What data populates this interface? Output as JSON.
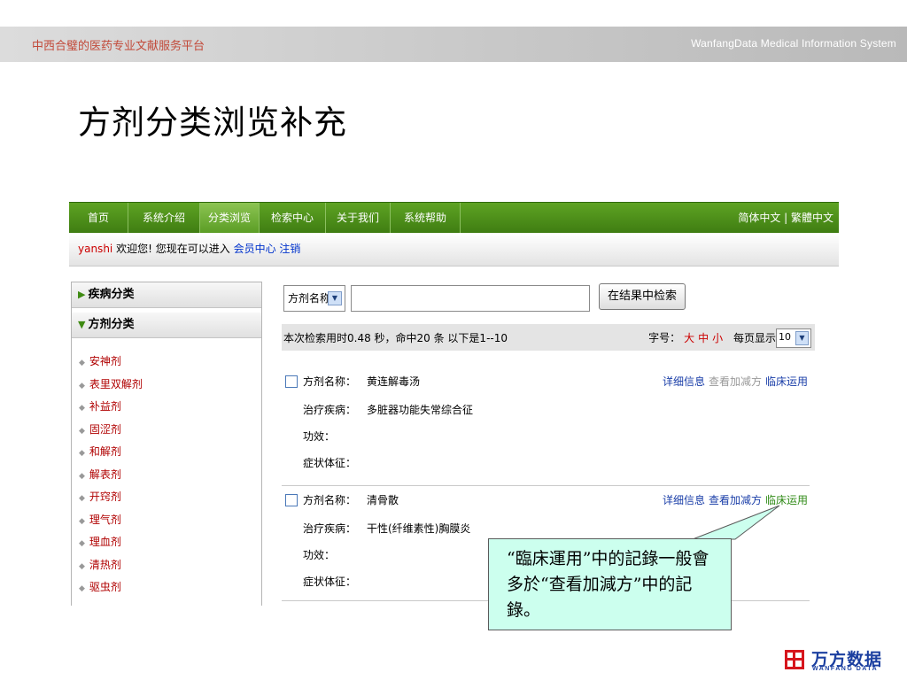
{
  "banner": {
    "left_text": "中西合璧的医药专业文献服务平台",
    "right_text": "WanfangData Medical Information System"
  },
  "slide": {
    "title": "方剂分类浏览补充"
  },
  "nav": {
    "items": [
      "首页",
      "系统介绍",
      "分类浏览",
      "检索中心",
      "关于我们",
      "系统帮助"
    ],
    "active": "分类浏览",
    "lang": "简体中文 | 繁體中文"
  },
  "welcome": {
    "user": "yanshi",
    "text1": "欢迎您!",
    "text2": "您现在可以进入",
    "member_link": "会员中心",
    "logout_link": "注销"
  },
  "sidebar": {
    "disease_header": "疾病分类",
    "formula_header": "方剂分类",
    "items": [
      "安神剂",
      "表里双解剂",
      "补益剂",
      "固涩剂",
      "和解剂",
      "解表剂",
      "开窍剂",
      "理气剂",
      "理血剂",
      "清热剂",
      "驱虫剂"
    ]
  },
  "search": {
    "field_select": "方剂名称",
    "query_value": "",
    "button_label": "在结果中检索"
  },
  "info": {
    "summary": "本次检索用时0.48 秒，命中20 条 以下是1--10",
    "font_size_label": "字号：",
    "size_large": "大",
    "size_medium": "中",
    "size_small": "小",
    "per_page_label": "每页显示",
    "per_page_value": "10"
  },
  "results": [
    {
      "name_label": "方剂名称：",
      "name": "黄连解毒汤",
      "disease_label": "治疗疾病：",
      "disease": "多脏器功能失常综合征",
      "effect_label": "功效：",
      "effect": "",
      "symptom_label": "症状体征：",
      "symptom": "",
      "action_detail": "详细信息",
      "action_modify": "查看加减方",
      "action_clinical": "临床运用"
    },
    {
      "name_label": "方剂名称：",
      "name": "清骨散",
      "disease_label": "治疗疾病：",
      "disease": "干性(纤维素性)胸膜炎",
      "effect_label": "功效：",
      "effect": "",
      "symptom_label": "症状体征：",
      "symptom": "",
      "action_detail": "详细信息",
      "action_modify": "查看加减方",
      "action_clinical": "临床运用"
    }
  ],
  "callout": {
    "text": "“臨床運用”中的記錄一般會多於“查看加減方”中的記錄。"
  },
  "logo": {
    "cn": "万方数据",
    "en": "WANFANG DATA"
  },
  "colors": {
    "nav_green": "#4a8f1a",
    "link_red": "#b00000",
    "link_blue": "#1a3ea8",
    "callout_bg": "#ccffee",
    "logo_red": "#d6161d",
    "logo_blue": "#1b3fa0"
  }
}
